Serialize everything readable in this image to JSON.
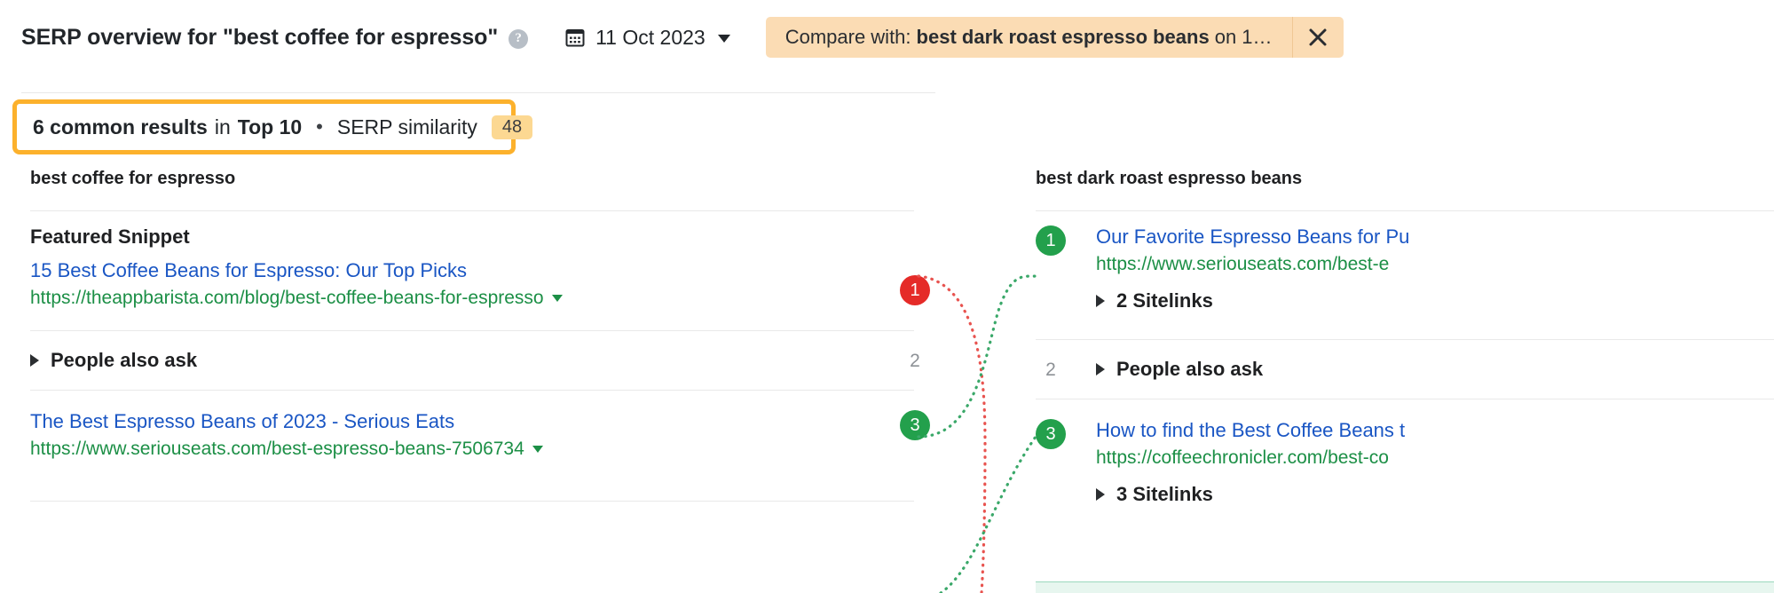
{
  "header": {
    "title": "SERP overview for \"best coffee for espresso\"",
    "help_icon": "question-mark-icon",
    "calendar_icon": "calendar-icon",
    "date": "11 Oct 2023",
    "compare_prefix": "Compare with:",
    "compare_keyword": "best dark roast espresso beans",
    "compare_suffix": "on 1…",
    "close_icon": "close-icon"
  },
  "summary": {
    "common_results": "6 common results",
    "in_word": "in",
    "top_n": "Top 10",
    "separator": "•",
    "similarity_label": "SERP similarity",
    "similarity_value": "48",
    "highlight_color": "#fcb12c",
    "badge_color": "#fcd892"
  },
  "left_column": {
    "keyword": "best coffee for espresso",
    "rows": [
      {
        "type": "featured_snippet",
        "label": "Featured Snippet",
        "title": "15 Best Coffee Beans for Espresso: Our Top Picks",
        "url": "https://theappbarista.com/blog/best-coffee-beans-for-espresso",
        "rank": "1",
        "rank_style": "red"
      },
      {
        "type": "people_also_ask",
        "label": "People also ask",
        "rank": "2",
        "rank_style": "plain"
      },
      {
        "type": "organic",
        "title": "The Best Espresso Beans of 2023 - Serious Eats",
        "url": "https://www.seriouseats.com/best-espresso-beans-7506734",
        "rank": "3",
        "rank_style": "green"
      }
    ]
  },
  "right_column": {
    "keyword": "best dark roast espresso beans",
    "rows": [
      {
        "type": "organic",
        "title": "Our Favorite Espresso Beans for Pu",
        "url": "https://www.seriouseats.com/best-e",
        "sitelinks": "2 Sitelinks",
        "rank": "1",
        "rank_style": "green"
      },
      {
        "type": "people_also_ask",
        "label": "People also ask",
        "rank": "2",
        "rank_style": "plain"
      },
      {
        "type": "organic",
        "title": "How to find the Best Coffee Beans t",
        "url": "https://coffeechronicler.com/best-co",
        "sitelinks": "3 Sitelinks",
        "rank": "3",
        "rank_style": "green"
      }
    ]
  },
  "colors": {
    "link": "#1a56c4",
    "url": "#1c8f46",
    "rank_red": "#e52b28",
    "rank_green": "#23a04c",
    "connector_red": "#e8534f",
    "connector_green": "#3aa869"
  }
}
